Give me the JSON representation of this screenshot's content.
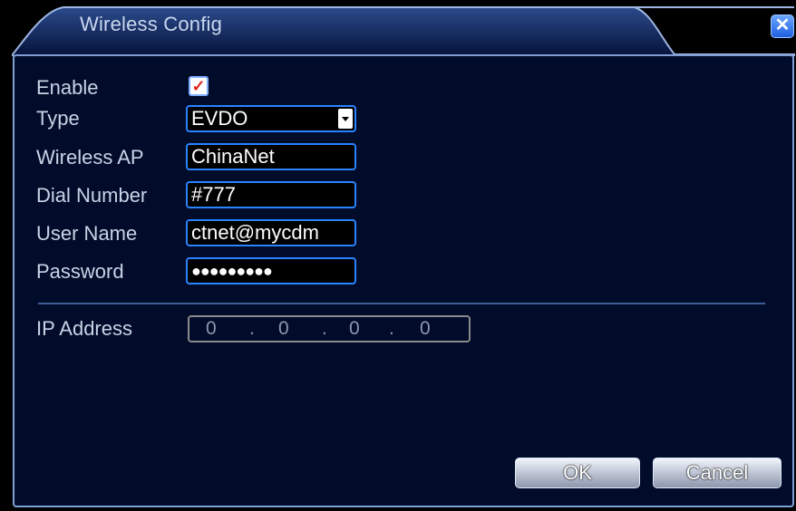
{
  "window": {
    "title": "Wireless Config"
  },
  "form": {
    "enable_label": "Enable",
    "enable_checked": true,
    "type_label": "Type",
    "type_value": "EVDO",
    "ap_label": "Wireless AP",
    "ap_value": "ChinaNet",
    "dial_label": "Dial Number",
    "dial_value": "#777",
    "user_label": "User Name",
    "user_value": "ctnet@mycdm",
    "password_label": "Password",
    "password_value": "●●●●●●●●●",
    "ip_label": "IP Address",
    "ip": [
      "0",
      "0",
      "0",
      "0"
    ],
    "ip_sep": "."
  },
  "buttons": {
    "ok": "OK",
    "cancel": "Cancel"
  },
  "icons": {
    "close": "close-icon",
    "dropdown": "chevron-down-icon",
    "check": "checkmark-icon"
  },
  "colors": {
    "panel": "#000c2a",
    "field_border": "#2a83ff",
    "title_bar": "#0a1a4a"
  }
}
